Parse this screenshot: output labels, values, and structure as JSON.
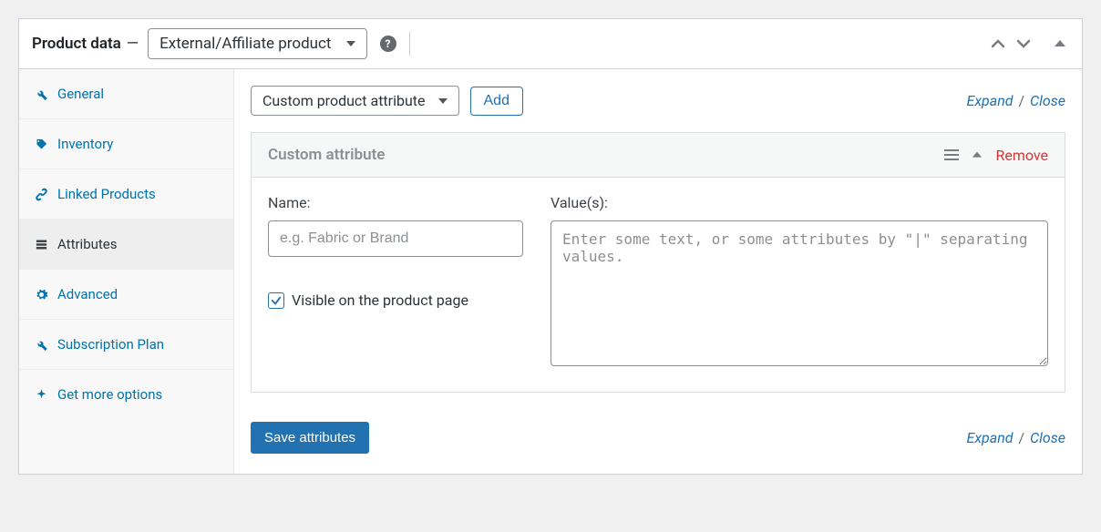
{
  "header": {
    "title": "Product data",
    "dash": "—",
    "product_type": "External/Affiliate product"
  },
  "sidebar": {
    "items": [
      {
        "label": "General"
      },
      {
        "label": "Inventory"
      },
      {
        "label": "Linked Products"
      },
      {
        "label": "Attributes"
      },
      {
        "label": "Advanced"
      },
      {
        "label": "Subscription Plan"
      },
      {
        "label": "Get more options"
      }
    ]
  },
  "attr": {
    "type_select": "Custom product attribute",
    "add_label": "Add",
    "expand_label": "Expand",
    "close_label": "Close",
    "block_title": "Custom attribute",
    "remove_label": "Remove",
    "name_label": "Name:",
    "name_placeholder": "e.g. Fabric or Brand",
    "values_label": "Value(s):",
    "values_placeholder": "Enter some text, or some attributes by \"|\" separating values.",
    "visible_label": "Visible on the product page",
    "save_label": "Save attributes"
  }
}
